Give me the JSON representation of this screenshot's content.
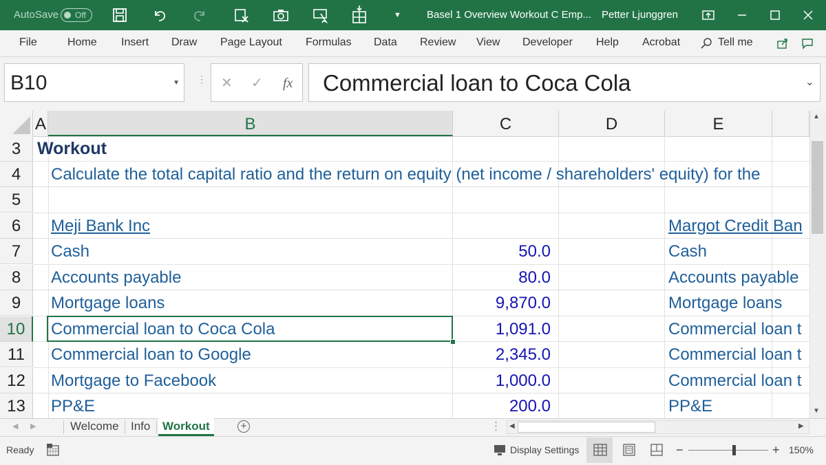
{
  "titlebar": {
    "autosave_label": "AutoSave",
    "autosave_state": "Off",
    "doc_title": "Basel 1 Overview Workout C Emp...",
    "user": "Petter Ljunggren"
  },
  "ribbon": {
    "tabs": [
      "File",
      "Home",
      "Insert",
      "Draw",
      "Page Layout",
      "Formulas",
      "Data",
      "Review",
      "View",
      "Developer",
      "Help",
      "Acrobat"
    ],
    "tell_me": "Tell me"
  },
  "formula_bar": {
    "name_box": "B10",
    "fx": "fx",
    "formula": "Commercial loan to Coca Cola"
  },
  "columns": [
    "A",
    "B",
    "C",
    "D",
    "E"
  ],
  "rows": [
    "3",
    "4",
    "5",
    "6",
    "7",
    "8",
    "9",
    "10",
    "11",
    "12",
    "13"
  ],
  "sheet": {
    "r3": {
      "a": "Workout"
    },
    "r4": {
      "b": "Calculate the total capital ratio and the return on equity (net income / shareholders' equity) for the"
    },
    "r6": {
      "b": "Meji Bank Inc",
      "e": "Margot Credit Ban"
    },
    "r7": {
      "b": "Cash",
      "c": "50.0",
      "e": "Cash"
    },
    "r8": {
      "b": "Accounts payable",
      "c": "80.0",
      "e": "Accounts payable"
    },
    "r9": {
      "b": "Mortgage loans",
      "c": "9,870.0",
      "e": "Mortgage loans"
    },
    "r10": {
      "b": "Commercial loan to Coca Cola",
      "c": "1,091.0",
      "e": "Commercial loan t"
    },
    "r11": {
      "b": "Commercial loan to Google",
      "c": "2,345.0",
      "e": "Commercial loan t"
    },
    "r12": {
      "b": "Mortgage to Facebook",
      "c": "1,000.0",
      "e": "Commercial loan t"
    },
    "r13": {
      "b": "PP&E",
      "c": "200.0",
      "e": "PP&E"
    }
  },
  "sheet_tabs": [
    "Welcome",
    "Info",
    "Workout"
  ],
  "status": {
    "ready": "Ready",
    "display_settings": "Display Settings",
    "zoom": "150%"
  },
  "colors": {
    "excel_green": "#217346",
    "text_blue": "#1f5f99",
    "number_blue": "#1414b4"
  }
}
